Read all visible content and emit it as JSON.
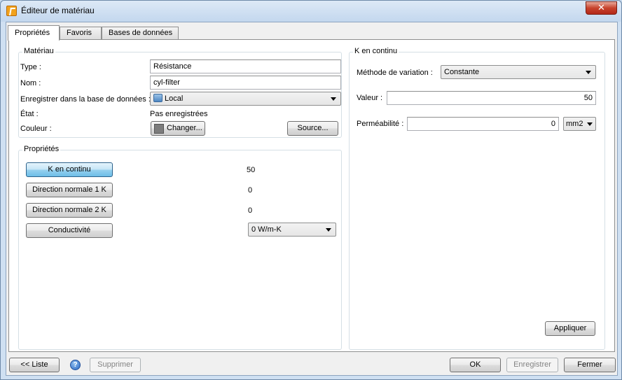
{
  "window": {
    "title": "Éditeur de matériau",
    "close_glyph": "✕"
  },
  "tabs": [
    {
      "label": "Propriétés",
      "active": true
    },
    {
      "label": "Favoris",
      "active": false
    },
    {
      "label": "Bases de données",
      "active": false
    }
  ],
  "material": {
    "legend": "Matériau",
    "type_label": "Type :",
    "type_value": "Résistance",
    "name_label": "Nom :",
    "name_value": "cyl-filter",
    "save_db_label": "Enregistrer dans la base de données :",
    "save_db_value": "Local",
    "state_label": "État :",
    "state_value": "Pas enregistrées",
    "color_label": "Couleur :",
    "color_swatch": "#7d7d7d",
    "change_button": "Changer...",
    "source_button": "Source..."
  },
  "properties": {
    "legend": "Propriétés",
    "rows": [
      {
        "button": "K en continu",
        "value": "50",
        "pressed": true
      },
      {
        "button": "Direction normale 1 K",
        "value": "0",
        "pressed": false
      },
      {
        "button": "Direction normale 2 K",
        "value": "0",
        "pressed": false
      },
      {
        "button": "Conductivité",
        "value": "0 W/m-K",
        "pressed": false
      }
    ]
  },
  "k_panel": {
    "legend": "K en continu",
    "method_label": "Méthode de variation :",
    "method_value": "Constante",
    "value_label": "Valeur :",
    "value_value": "50",
    "perm_label": "Perméabilité :",
    "perm_value": "0",
    "perm_unit": "mm2",
    "apply_button": "Appliquer"
  },
  "footer": {
    "list_button": "<< Liste",
    "help_glyph": "?",
    "delete_button": "Supprimer",
    "ok_button": "OK",
    "save_button": "Enregistrer",
    "close_button": "Fermer"
  }
}
